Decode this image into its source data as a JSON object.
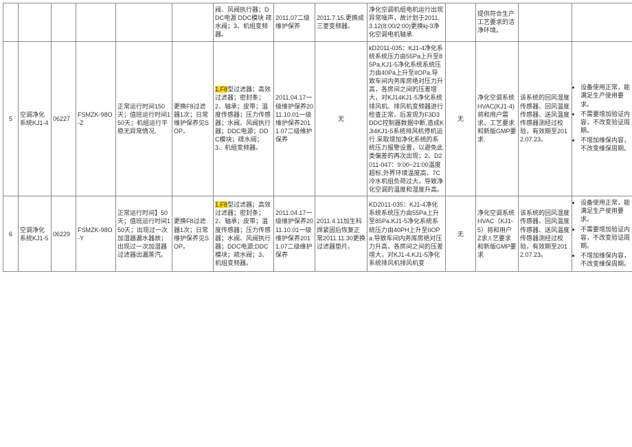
{
  "rows": [
    {
      "cols": {
        "c0": "",
        "c1": "",
        "c2": "",
        "c3": "",
        "c4": "",
        "c5": "",
        "c6": "阀、风阀执行器；DDC电源 DDC模块 疏水阀；3、机组变频器。",
        "c7": "2011.07二级维护保养",
        "c8": "2011.7.15.更换成三菱变频器。",
        "c9": "净化空调机组电机运行出现异常噪声，故计划于2011.3.12(8:00/2:00)更换kj-3净化空调电机轴承.",
        "c10": "",
        "c11": "提供符合生产工艺要求的洁净环境。",
        "c12": "",
        "c13": ""
      }
    },
    {
      "no": "5",
      "name": "空调净化系统KJ1-4",
      "code": "06227",
      "model": "FSMZK-98O-Z",
      "runtime": "正常运行时间150天；值班运行时间150天；机组运行平稳无异常情况.",
      "replace": "更换F8过滤器1次；日常维护保养见SOP。",
      "f8hl": "1.F8",
      "f8rest": "型过滤器；高效过滤器；密封条；2、轴承；皮带；温度传感器；压力传感器；水阀、风阀执行器；DDC电源；DDC模块；疏水阀；3、机组变频器。",
      "maint": "2011.04.17一级维护保养2011.10.01一级维护保养2011.07二级维护保养",
      "none": "无",
      "kd": "kD2011-035：KJ1-4净化系统系统压力由55Pa上升至85Pa,KJ1-5净化系统系统压力由40Pa上升至IIOPa.导致车间内务库房绝对压力升高，各房间之间的压差增大，对KJ14KJ1-5净化系统排风机、排风机变频器进行检查正常，后发现为F3D3DDC控制器数据中断,造成KJI4KJ1-5系统排风机停机运行.采取增加净化系统的系统压力报警设置，以避免此类偏差的再次出现；2、D2011-047：9:00~21:00温度超标,外界环境温度高，7C冷水机组负荷过大，导致净化空调的温度和湿度升高。",
      "none2": "无",
      "purpose": "净化空调系统HVAC(KJ1-4)将和用户需求、工艺要求和新版GMP要求.",
      "sensor": "该系统的回风湿度传感器、回风温度传感器、送风温度传感器测经过校验，有效期至2012.07.23。",
      "bul1": "设备使用正常，能满足生产使用要求。",
      "bul2": "不需要增加验证内容，不改变验证周期。",
      "bul3": "不增加维保内容，不改变维保周期。"
    },
    {
      "no": "6",
      "name": "空调净化系统KJ1-5",
      "code": "06229",
      "model": "FSMZK-98O-Y",
      "runtime": "正常运行时间】50天；值班运行时间150天；出现过一次加湿器漏水器故；出现过一次加湿器过滤器出漏蒸汽。",
      "replace": "更换F8过滤器1次；日常维护保养见SOP。",
      "f8hl": "1.F8",
      "f8rest": "型过滤器；高效过滤器；密封条；2、轴承；皮带；温度传感器；压力传感器；水阀、风阀执行器；DDC电源;DDC模块；疏水阀；3、机组变频器。",
      "maint": "2011.04.17一级维护保养2011.10.01一级维护保养2011.07二级维护保养",
      "c8": "2011.4.11加生科焊紧固后恢复正常2011.11.30更换过滤器垫片。",
      "kd": "KD2011-035：KJ1-4净化系统系统压力由55Pa上升至85Pa.KJ1-5净化系统系统压力由40PH上升至IIOPa.导致车间内务库房绝对压力升高，各房间之间的压差增大，对KJ1-4.KJ1-5净化系统排风机排风机变",
      "none2": "无",
      "purpose": "净化空调系统HVAC（KJ1-5）将和用户 Z求,I.艺要求和新版GMP要求",
      "sensor": "该系统的回风湿度传感器、回风温度传感器、送风温度传感器测经过校验，有效期至2012.07.23。",
      "bul1": "设备使用正常，能满足生产使用要求。",
      "bul2": "不需要增加验证内容，不改变验证周期。",
      "bul3": "不增加维保内容，不改变维保周期。"
    }
  ]
}
